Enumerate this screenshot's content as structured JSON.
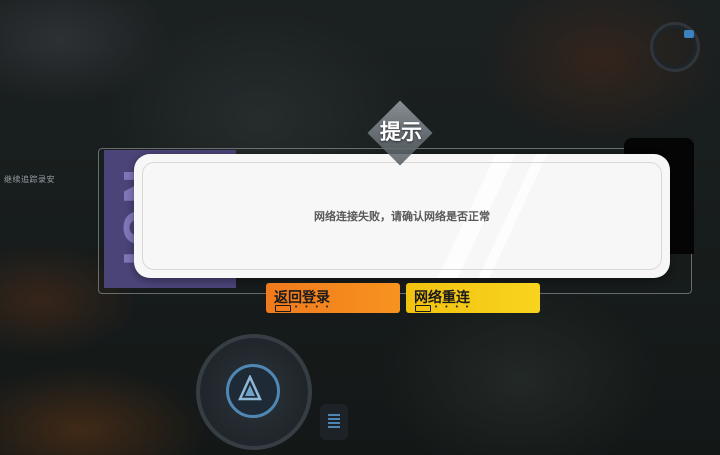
{
  "background": {
    "hint_text": "继续追踪录安"
  },
  "dialog": {
    "title": "提示",
    "message": "网络连接失败，请确认网络是否正常",
    "tab_letters": "NOI"
  },
  "buttons": {
    "back_label": "返回登录",
    "retry_label": "网络重连",
    "dots": "• • • •"
  },
  "colors": {
    "back_button": "#f7931f",
    "retry_button": "#f8d41f",
    "purple_tab": "#4a4478",
    "dialog_bg": "#f7f7f7"
  },
  "icons": [
    "play-triangle-icon",
    "key-hint-icon"
  ]
}
